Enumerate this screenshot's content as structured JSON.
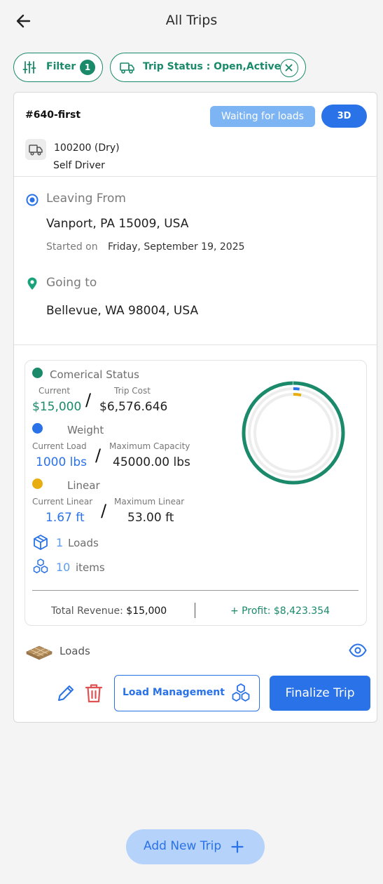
{
  "header": {
    "title": "All Trips",
    "back_icon": "arrow-left-icon"
  },
  "filters": {
    "filter_label": "Filter",
    "filter_count": "1",
    "status_label": "Trip Status : Open,Active"
  },
  "trip": {
    "id": "#640-first",
    "status_badge": "Waiting for loads",
    "view_3d_label": "3D",
    "vehicle": "100200 (Dry)",
    "driver": "Self Driver",
    "origin": {
      "label": "Leaving From",
      "address": "Vanport, PA 15009, USA",
      "started_label": "Started on",
      "started_date": "Friday, September 19, 2025"
    },
    "destination": {
      "label": "Going to",
      "address": "Bellevue, WA 98004, USA"
    },
    "stats": {
      "commercial": {
        "title": "Comerical Status",
        "current_label": "Current",
        "current_value": "$15,000",
        "cost_label": "Trip Cost",
        "cost_value": "$6,576.646",
        "color": "#1a8a6a",
        "ratio": 0.998
      },
      "weight": {
        "title": "Weight",
        "current_label": "Current Load",
        "current_value": "1000 lbs",
        "max_label": "Maximum Capacity",
        "max_value": "45000.00 lbs",
        "color": "#2a72e8",
        "ratio": 0.022
      },
      "linear": {
        "title": "Linear",
        "current_label": "Current Linear",
        "current_value": "1.67 ft",
        "max_label": "Maximum Linear",
        "max_value": "53.00 ft",
        "color": "#e8ae10",
        "ratio": 0.032
      },
      "loads_count": "1",
      "loads_label": "Loads",
      "items_count": "10",
      "items_label": "items",
      "total_revenue_label": "Total Revenue:",
      "total_revenue_value": "$15,000",
      "profit_label": "+ Profit:",
      "profit_value": "$8,423.354"
    },
    "loads_section_label": "Loads",
    "load_management_label": "Load Management",
    "finalize_label": "Finalize Trip"
  },
  "footer": {
    "add_trip_label": "Add New Trip"
  },
  "colors": {
    "accent": "#2a72e8",
    "success": "#1a8a6a",
    "danger": "#e05252",
    "badge_light_blue": "#7db4f3"
  }
}
